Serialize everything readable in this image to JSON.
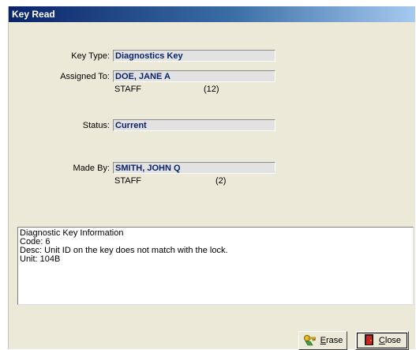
{
  "window": {
    "title": "Key Read"
  },
  "fields": {
    "key_type": {
      "label": "Key Type:",
      "value": "Diagnostics Key"
    },
    "assigned_to": {
      "label": "Assigned To:",
      "value": "DOE, JANE A",
      "role": "STAFF",
      "id": "(12)"
    },
    "status": {
      "label": "Status:",
      "value": "Current"
    },
    "made_by": {
      "label": "Made By:",
      "value": "SMITH, JOHN Q",
      "role": "STAFF",
      "id": "(2)"
    }
  },
  "info": {
    "lines": [
      "Diagnostic Key Information",
      "Code: 6",
      "Desc: Unit ID on the key does not match with the lock.",
      "Unit: 104B"
    ]
  },
  "buttons": {
    "erase": {
      "label": "Erase",
      "icon": "key-erase-icon"
    },
    "close": {
      "label": "Close",
      "icon": "door-exit-icon"
    }
  },
  "colors": {
    "title_bar": "#0a246a",
    "field_text": "#0a246a",
    "dialog_bg": "#ece9d8"
  }
}
